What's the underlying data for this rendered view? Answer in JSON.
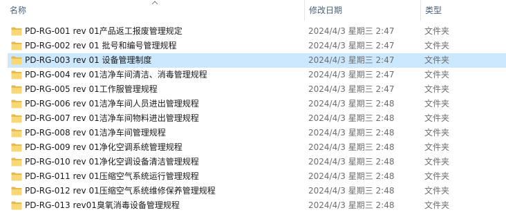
{
  "header": {
    "name": "名称",
    "date_modified": "修改日期",
    "type": "类型"
  },
  "files": [
    {
      "name": "PD-RG-001 rev 01产品返工报废管理规定",
      "date": "2024/4/3 星期三 2:47",
      "type": "文件夹",
      "icon": "folder-icon"
    },
    {
      "name": "PD-RG-002 rev 01 批号和编号管理规程",
      "date": "2024/4/3 星期三 2:47",
      "type": "文件夹",
      "icon": "folder-icon"
    },
    {
      "name": "PD-RG-003 rev 01 设备管理制度",
      "date": "2024/4/3 星期三 2:47",
      "type": "文件夹",
      "icon": "folder-icon",
      "selected": true
    },
    {
      "name": "PD-RG-004 rev 01洁净车间清洁、消毒管理规程",
      "date": "2024/4/3 星期三 2:47",
      "type": "文件夹",
      "icon": "folder-icon"
    },
    {
      "name": "PD-RG-005 rev 01工作服管理规程",
      "date": "2024/4/3 星期三 2:47",
      "type": "文件夹",
      "icon": "folder-icon"
    },
    {
      "name": "PD-RG-006 rev 01洁净车间人员进出管理规程",
      "date": "2024/4/3 星期三 2:48",
      "type": "文件夹",
      "icon": "folder-icon"
    },
    {
      "name": "PD-RG-007 rev 01洁净车间物料进出管理规程",
      "date": "2024/4/3 星期三 2:48",
      "type": "文件夹",
      "icon": "folder-icon"
    },
    {
      "name": "PD-RG-008 rev 01洁净车间管理规程",
      "date": "2024/4/3 星期三 2:48",
      "type": "文件夹",
      "icon": "folder-icon"
    },
    {
      "name": "PD-RG-009 rev 01净化空调系统管理规程",
      "date": "2024/4/3 星期三 2:48",
      "type": "文件夹",
      "icon": "folder-icon"
    },
    {
      "name": "PD-RG-010 rev 01净化空调设备清洁管理规程",
      "date": "2024/4/3 星期三 2:48",
      "type": "文件夹",
      "icon": "folder-icon"
    },
    {
      "name": "PD-RG-011 rev 01压缩空气系统运行管理规程",
      "date": "2024/4/3 星期三 2:48",
      "type": "文件夹",
      "icon": "folder-icon"
    },
    {
      "name": "PD-RG-012 rev 01压缩空气系统维修保养管理规程",
      "date": "2024/4/3 星期三 2:48",
      "type": "文件夹",
      "icon": "folder-icon"
    },
    {
      "name": "PD-RG-013 rev01臭氧消毒设备管理规程",
      "date": "2024/4/3 星期三 2:48",
      "type": "文件夹",
      "icon": "folder-icon"
    }
  ],
  "colors": {
    "folder": "#f8d775",
    "folder_dark": "#e8b84a",
    "selection": "#cce8ff",
    "header_text": "#4c607a"
  }
}
